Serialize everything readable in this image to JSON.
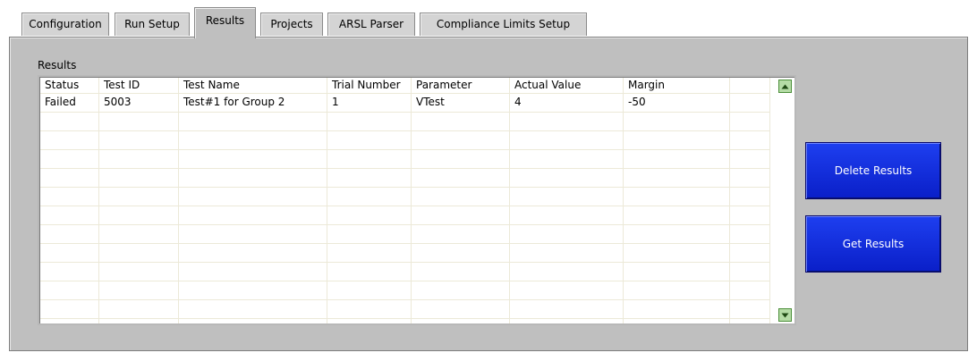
{
  "tabs": [
    {
      "label": "Configuration",
      "active": false
    },
    {
      "label": "Run Setup",
      "active": false
    },
    {
      "label": "Results",
      "active": true
    },
    {
      "label": "Projects",
      "active": false
    },
    {
      "label": "ARSL Parser",
      "active": false
    },
    {
      "label": "Compliance Limits Setup",
      "active": false
    }
  ],
  "results": {
    "group_label": "Results",
    "columns": [
      "Status",
      "Test ID",
      "Test Name",
      "Trial Number",
      "Parameter",
      "Actual Value",
      "Margin",
      ""
    ],
    "rows": [
      [
        "Failed",
        "5003",
        "Test#1 for Group 2",
        "1",
        "VTest",
        "4",
        "-50",
        ""
      ]
    ]
  },
  "buttons": {
    "delete_results": "Delete Results",
    "get_results": "Get Results"
  },
  "colors": {
    "panel_bg": "#bfbfbf",
    "button_blue": "#1530e0",
    "grid_line": "#ece9d8",
    "scroll_green": "#b5dca6"
  },
  "icons": {
    "scroll_up": "scroll-up-arrow-icon",
    "scroll_down": "scroll-down-arrow-icon"
  }
}
